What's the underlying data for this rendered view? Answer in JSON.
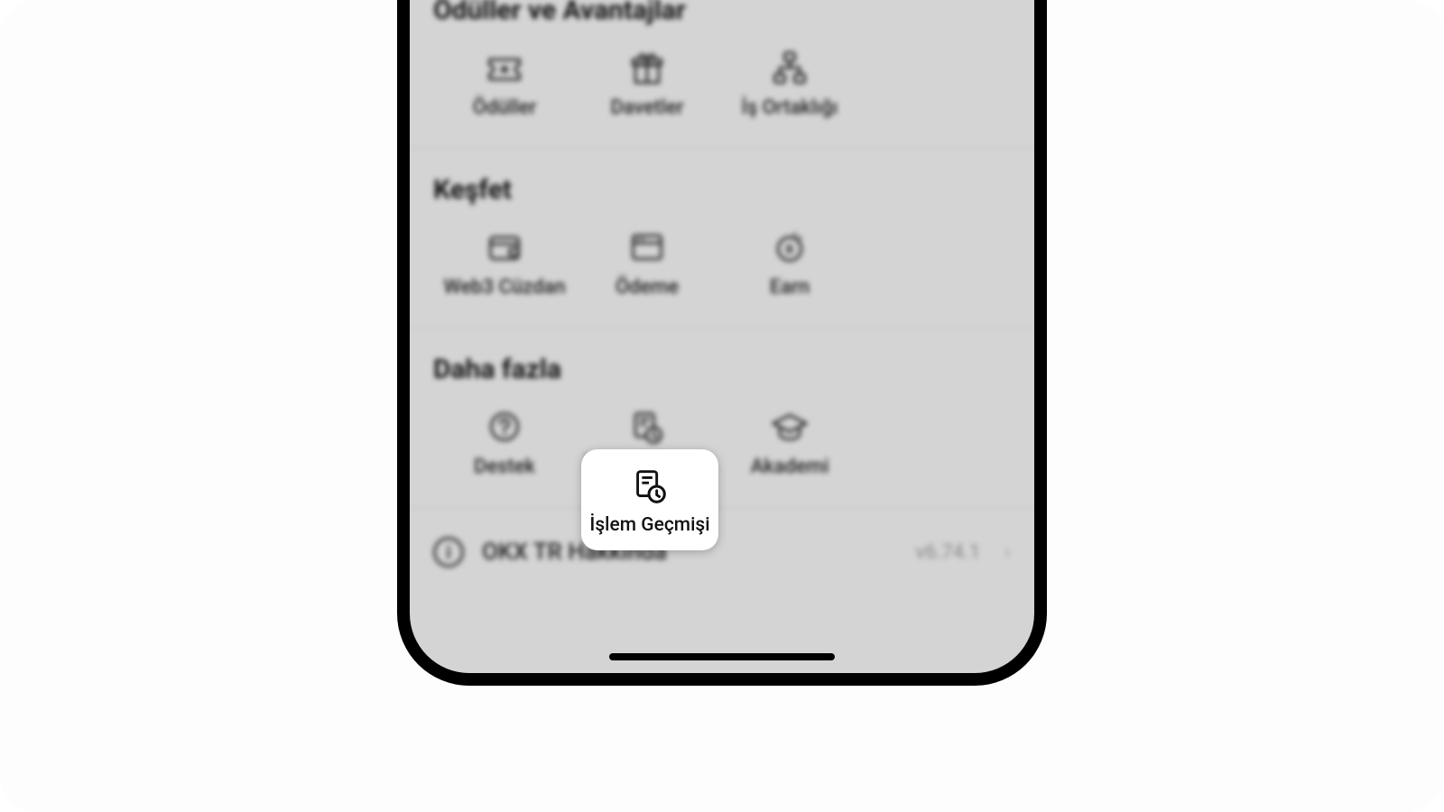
{
  "sections": {
    "rewards": {
      "title": "Ödüller ve Avantajlar",
      "items": [
        {
          "label": "Ödüller",
          "icon": "ticket-star"
        },
        {
          "label": "Davetler",
          "icon": "gift"
        },
        {
          "label": "İş Ortaklığı",
          "icon": "org-chart"
        }
      ]
    },
    "discover": {
      "title": "Keşfet",
      "items": [
        {
          "label": "Web3 Cüzdan",
          "icon": "wallet"
        },
        {
          "label": "Ödeme",
          "icon": "browser-window"
        },
        {
          "label": "Earn",
          "icon": "coin-speed"
        }
      ]
    },
    "more": {
      "title": "Daha fazla",
      "items": [
        {
          "label": "Destek",
          "icon": "help-circle"
        },
        {
          "label": "İşlem Geçmişi",
          "icon": "doc-clock",
          "highlighted": true
        },
        {
          "label": "Akademi",
          "icon": "grad-cap"
        }
      ]
    }
  },
  "about": {
    "label": "OKX TR Hakkında",
    "version": "v6.74.1"
  }
}
